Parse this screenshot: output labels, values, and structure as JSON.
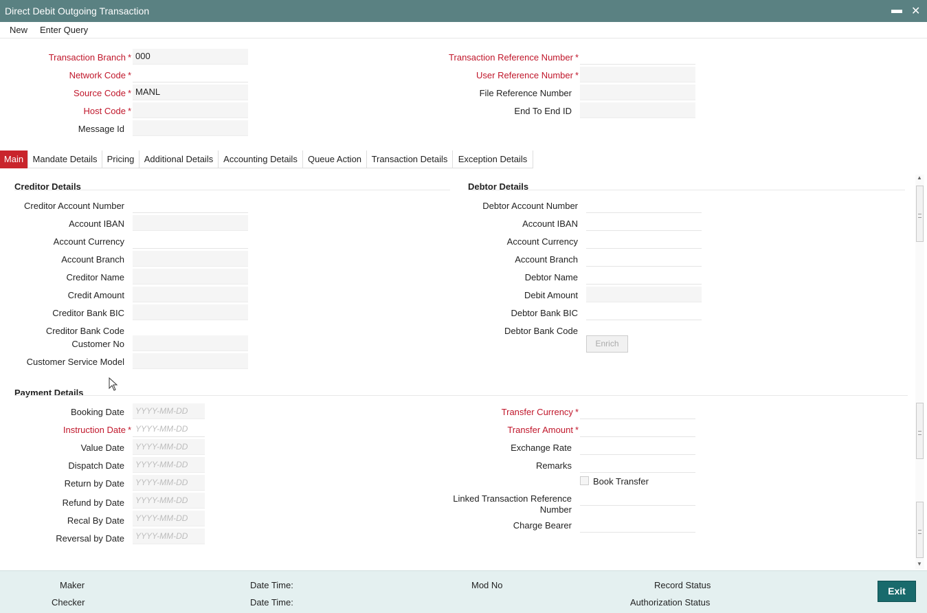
{
  "window": {
    "title": "Direct Debit Outgoing Transaction"
  },
  "menu": {
    "new": "New",
    "enter_query": "Enter Query"
  },
  "header": {
    "transaction_branch": {
      "label": "Transaction Branch",
      "value": "000"
    },
    "network_code": {
      "label": "Network Code",
      "value": ""
    },
    "source_code": {
      "label": "Source Code",
      "value": "MANL"
    },
    "host_code": {
      "label": "Host Code",
      "value": ""
    },
    "message_id": {
      "label": "Message Id",
      "value": ""
    },
    "transaction_reference_number": {
      "label": "Transaction Reference Number",
      "value": ""
    },
    "user_reference_number": {
      "label": "User Reference Number",
      "value": ""
    },
    "file_reference_number": {
      "label": "File Reference Number",
      "value": ""
    },
    "end_to_end_id": {
      "label": "End To End ID",
      "value": ""
    },
    "required_marker": "*"
  },
  "tabs": [
    "Main",
    "Mandate Details",
    "Pricing",
    "Additional Details",
    "Accounting Details",
    "Queue Action",
    "Transaction Details",
    "Exception Details"
  ],
  "creditor": {
    "title": "Creditor Details",
    "account_number": "Creditor Account Number",
    "account_iban": "Account IBAN",
    "account_currency": "Account Currency",
    "account_branch": "Account Branch",
    "name": "Creditor Name",
    "amount": "Credit Amount",
    "bank_bic": "Creditor Bank BIC",
    "bank_code": "Creditor Bank Code",
    "customer_no": "Customer No",
    "customer_service_model": "Customer Service Model"
  },
  "debtor": {
    "title": "Debtor Details",
    "account_number": "Debtor Account Number",
    "account_iban": "Account IBAN",
    "account_currency": "Account Currency",
    "account_branch": "Account Branch",
    "name": "Debtor Name",
    "amount": "Debit Amount",
    "bank_bic": "Debtor Bank BIC",
    "bank_code": "Debtor Bank Code",
    "enrich_button": "Enrich"
  },
  "payment": {
    "title": "Payment Details",
    "date_placeholder": "YYYY-MM-DD",
    "booking_date": "Booking Date",
    "instruction_date": "Instruction Date",
    "value_date": "Value Date",
    "dispatch_date": "Dispatch Date",
    "return_by_date": "Return by Date",
    "refund_by_date": "Refund by Date",
    "recal_by_date": "Recal By Date",
    "reversal_by_date": "Reversal by Date",
    "transfer_currency": "Transfer Currency",
    "transfer_amount": "Transfer Amount",
    "exchange_rate": "Exchange Rate",
    "remarks": "Remarks",
    "book_transfer": "Book Transfer",
    "linked_ref_line1": "Linked Transaction Reference",
    "linked_ref_line2": "Number",
    "charge_bearer": "Charge Bearer"
  },
  "footer": {
    "maker": "Maker",
    "checker": "Checker",
    "date_time": "Date Time:",
    "mod_no": "Mod No",
    "record_status": "Record Status",
    "authorization_status": "Authorization Status",
    "exit": "Exit"
  },
  "colors": {
    "title_bar": "#5a8182",
    "required": "#c0162a",
    "active_tab": "#c9252c",
    "exit_button": "#196a6c",
    "footer": "#e4f0f0"
  },
  "icons": {
    "minimize": "minimize-icon",
    "close": "close-icon",
    "cursor": "mouse-pointer-icon"
  }
}
